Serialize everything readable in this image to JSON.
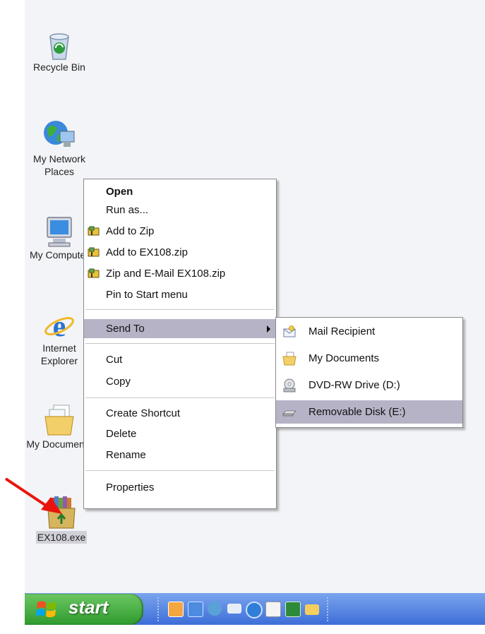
{
  "desktop": {
    "icons": [
      {
        "label": "Recycle Bin",
        "icon": "recycle-bin-icon"
      },
      {
        "label": "My Network\nPlaces",
        "icon": "network-places-icon"
      },
      {
        "label": "My Computer",
        "icon": "computer-icon"
      },
      {
        "label": "Internet\nExplorer",
        "icon": "internet-explorer-icon"
      },
      {
        "label": "My Documents",
        "icon": "documents-folder-icon"
      },
      {
        "label": "EX108.exe",
        "icon": "package-exe-icon"
      }
    ]
  },
  "context_menu": {
    "items": [
      {
        "label": "Open",
        "bold": true
      },
      {
        "label": "Run as..."
      },
      {
        "label": "Add to Zip",
        "icon": "zip-icon"
      },
      {
        "label": "Add to EX108.zip",
        "icon": "zip-icon"
      },
      {
        "label": "Zip and E-Mail EX108.zip",
        "icon": "zip-icon"
      },
      {
        "label": "Pin to Start menu"
      },
      {
        "label": "Send To",
        "highlighted": true,
        "submenu": true
      },
      {
        "label": "Cut"
      },
      {
        "label": "Copy"
      },
      {
        "label": "Create Shortcut"
      },
      {
        "label": "Delete"
      },
      {
        "label": "Rename"
      },
      {
        "label": "Properties"
      }
    ]
  },
  "send_to_menu": {
    "items": [
      {
        "label": "Mail Recipient",
        "icon": "mail-recipient-icon"
      },
      {
        "label": "My Documents",
        "icon": "my-documents-icon"
      },
      {
        "label": "DVD-RW Drive (D:)",
        "icon": "dvd-drive-icon"
      },
      {
        "label": "Removable Disk (E:)",
        "icon": "removable-disk-icon",
        "highlighted": true
      }
    ]
  },
  "taskbar": {
    "start_label": "start",
    "quick_launch": [
      "clock-icon",
      "ie-icon",
      "database-icon",
      "mail-icon",
      "media-player-icon",
      "document-icon",
      "excel-icon",
      "folder-icon"
    ]
  },
  "colors": {
    "menu_highlight": "#b6b3c6",
    "annotation_arrow": "#e8150c",
    "taskbar_blue": "#3d6ed8",
    "start_green": "#2e9b2e"
  }
}
